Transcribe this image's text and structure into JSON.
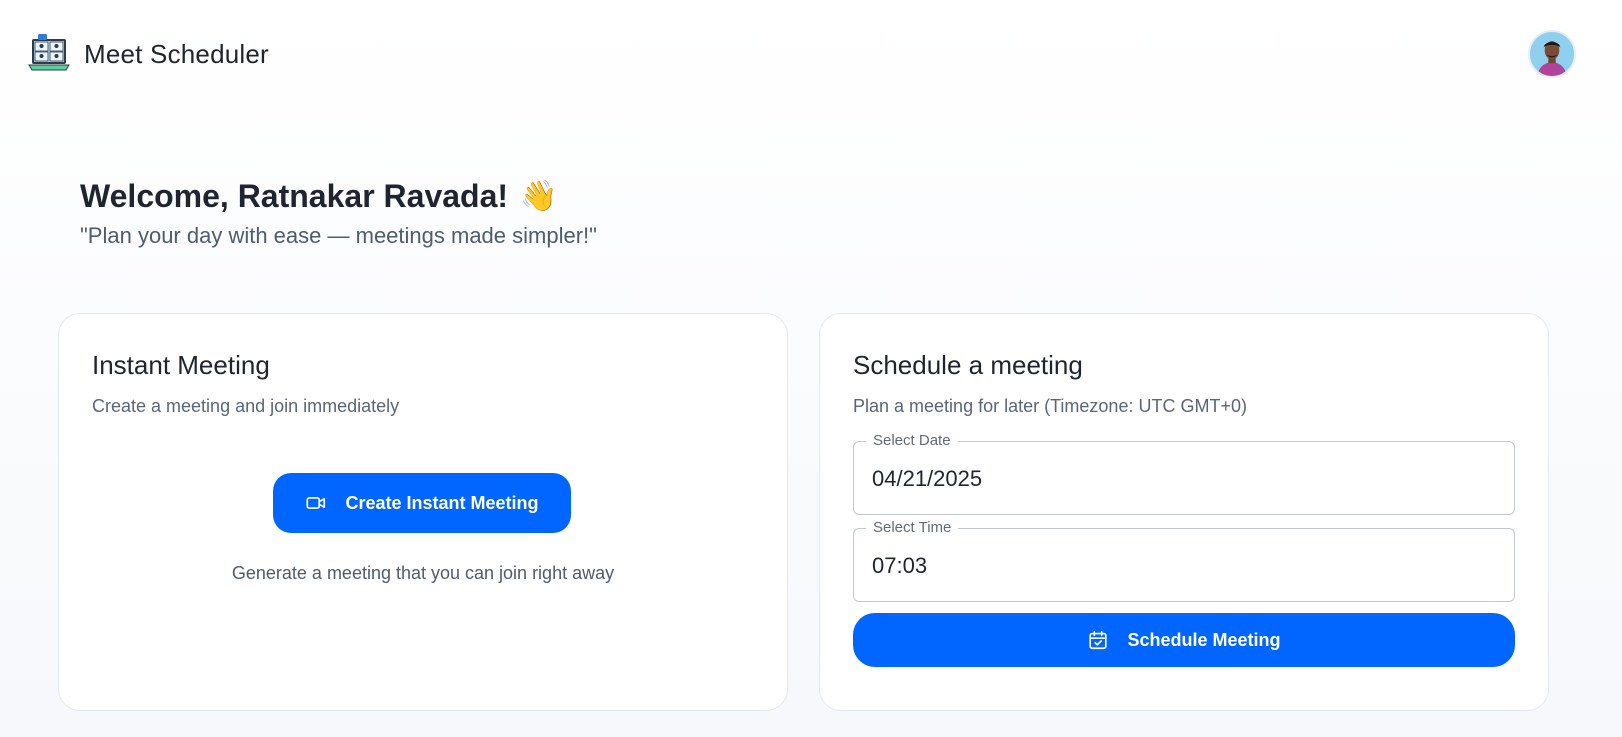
{
  "header": {
    "app_title": "Meet Scheduler",
    "logo_icon": "video-conference-laptop-icon",
    "avatar_icon": "user-avatar"
  },
  "welcome": {
    "title": "Welcome, Ratnakar Ravada!",
    "emoji": "👋",
    "subtitle": "\"Plan your day with ease — meetings made simpler!\""
  },
  "instant": {
    "title": "Instant Meeting",
    "description": "Create a meeting and join immediately",
    "button_label": "Create Instant Meeting",
    "button_icon": "video-camera-icon",
    "hint": "Generate a meeting that you can join right away"
  },
  "schedule": {
    "title": "Schedule a meeting",
    "description": "Plan a meeting for later (Timezone: UTC GMT+0)",
    "date_label": "Select Date",
    "date_value": "04/21/2025",
    "time_label": "Select Time",
    "time_value": "07:03",
    "button_label": "Schedule Meeting",
    "button_icon": "calendar-check-icon"
  },
  "colors": {
    "primary": "#0066ff",
    "text_dark": "#1f2430",
    "text_muted": "#4f5b70"
  }
}
